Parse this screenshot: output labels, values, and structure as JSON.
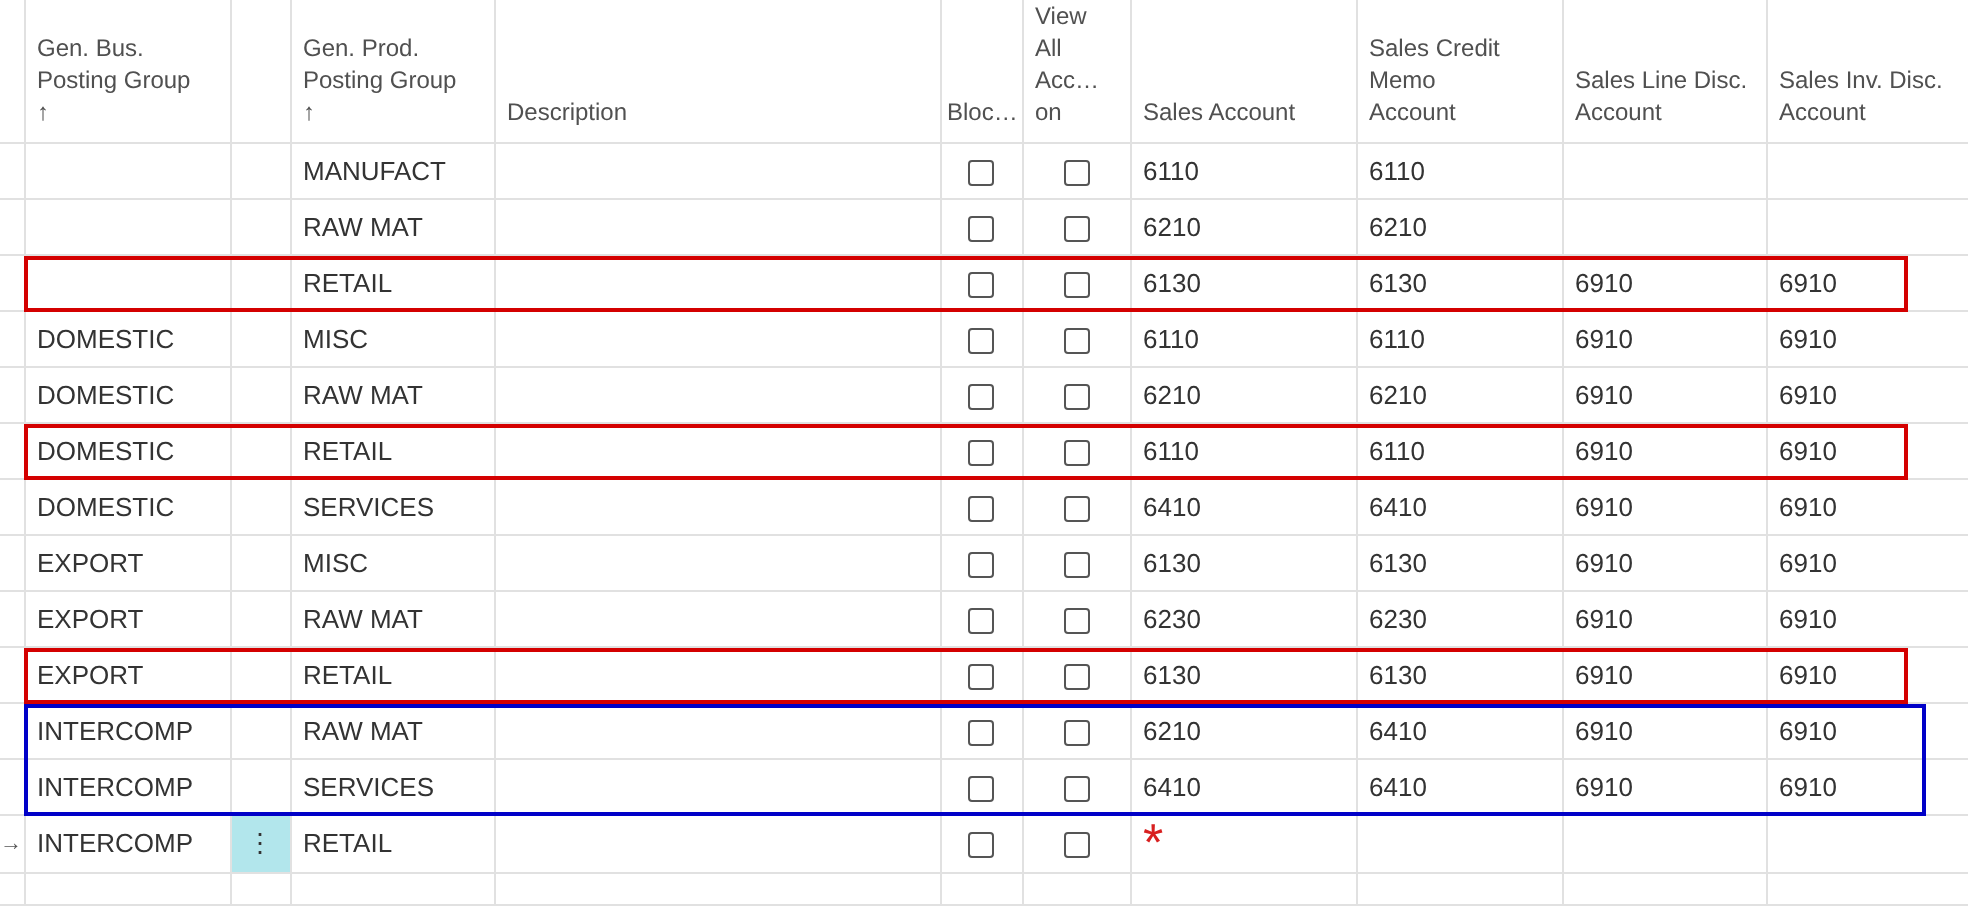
{
  "columns": [
    {
      "label": "Gen. Bus.\nPosting Group",
      "sort": "↑"
    },
    {
      "label": "Gen. Prod.\nPosting Group",
      "sort": "↑"
    },
    {
      "label": "Description"
    },
    {
      "label": "Bloc…",
      "kind": "check"
    },
    {
      "label": "View\nAll\nAcc…\non",
      "kind": "check"
    },
    {
      "label": "Sales Account"
    },
    {
      "label": "Sales Credit\nMemo\nAccount"
    },
    {
      "label": "Sales Line Disc.\nAccount"
    },
    {
      "label": "Sales Inv. Disc.\nAccount"
    }
  ],
  "rows": [
    {
      "prod": "MANUFACT",
      "blocked": false,
      "view_all": false,
      "sales": "6110",
      "credit": "6110"
    },
    {
      "prod": "RAW MAT",
      "blocked": false,
      "view_all": false,
      "sales": "6210",
      "credit": "6210"
    },
    {
      "prod": "RETAIL",
      "blocked": false,
      "view_all": false,
      "sales": "6130",
      "credit": "6130",
      "line_disc": "6910",
      "inv_disc": "6910",
      "color": "#d40000"
    },
    {
      "bus": "DOMESTIC",
      "prod": "MISC",
      "blocked": false,
      "view_all": false,
      "sales": "6110",
      "credit": "6110",
      "line_disc": "6910",
      "inv_disc": "6910"
    },
    {
      "bus": "DOMESTIC",
      "prod": "RAW MAT",
      "blocked": false,
      "view_all": false,
      "sales": "6210",
      "credit": "6210",
      "line_disc": "6910",
      "inv_disc": "6910"
    },
    {
      "bus": "DOMESTIC",
      "prod": "RETAIL",
      "blocked": false,
      "view_all": false,
      "sales": "6110",
      "credit": "6110",
      "line_disc": "6910",
      "inv_disc": "6910",
      "color": "#d40000"
    },
    {
      "bus": "DOMESTIC",
      "prod": "SERVICES",
      "blocked": false,
      "view_all": false,
      "sales": "6410",
      "credit": "6410",
      "line_disc": "6910",
      "inv_disc": "6910"
    },
    {
      "bus": "EXPORT",
      "prod": "MISC",
      "blocked": false,
      "view_all": false,
      "sales": "6130",
      "credit": "6130",
      "line_disc": "6910",
      "inv_disc": "6910"
    },
    {
      "bus": "EXPORT",
      "prod": "RAW MAT",
      "blocked": false,
      "view_all": false,
      "sales": "6230",
      "credit": "6230",
      "line_disc": "6910",
      "inv_disc": "6910"
    },
    {
      "bus": "EXPORT",
      "prod": "RETAIL",
      "blocked": false,
      "view_all": false,
      "sales": "6130",
      "credit": "6130",
      "line_disc": "6910",
      "inv_disc": "6910",
      "color": "#d40000"
    },
    {
      "bus": "INTERCOMP",
      "prod": "RAW MAT",
      "blocked": false,
      "view_all": false,
      "sales": "6210",
      "credit": "6410",
      "line_disc": "6910",
      "inv_disc": "6910",
      "color": "#0000c8"
    },
    {
      "bus": "INTERCOMP",
      "prod": "SERVICES",
      "blocked": false,
      "view_all": false,
      "sales": "6410",
      "credit": "6410",
      "line_disc": "6910",
      "inv_disc": "6910",
      "color": "#0000c8"
    },
    {
      "current": true,
      "marker": "→",
      "actions": "⋮",
      "bus": "INTERCOMP",
      "prod": "RETAIL",
      "blocked": false,
      "view_all": false,
      "required_mark": "*"
    }
  ]
}
